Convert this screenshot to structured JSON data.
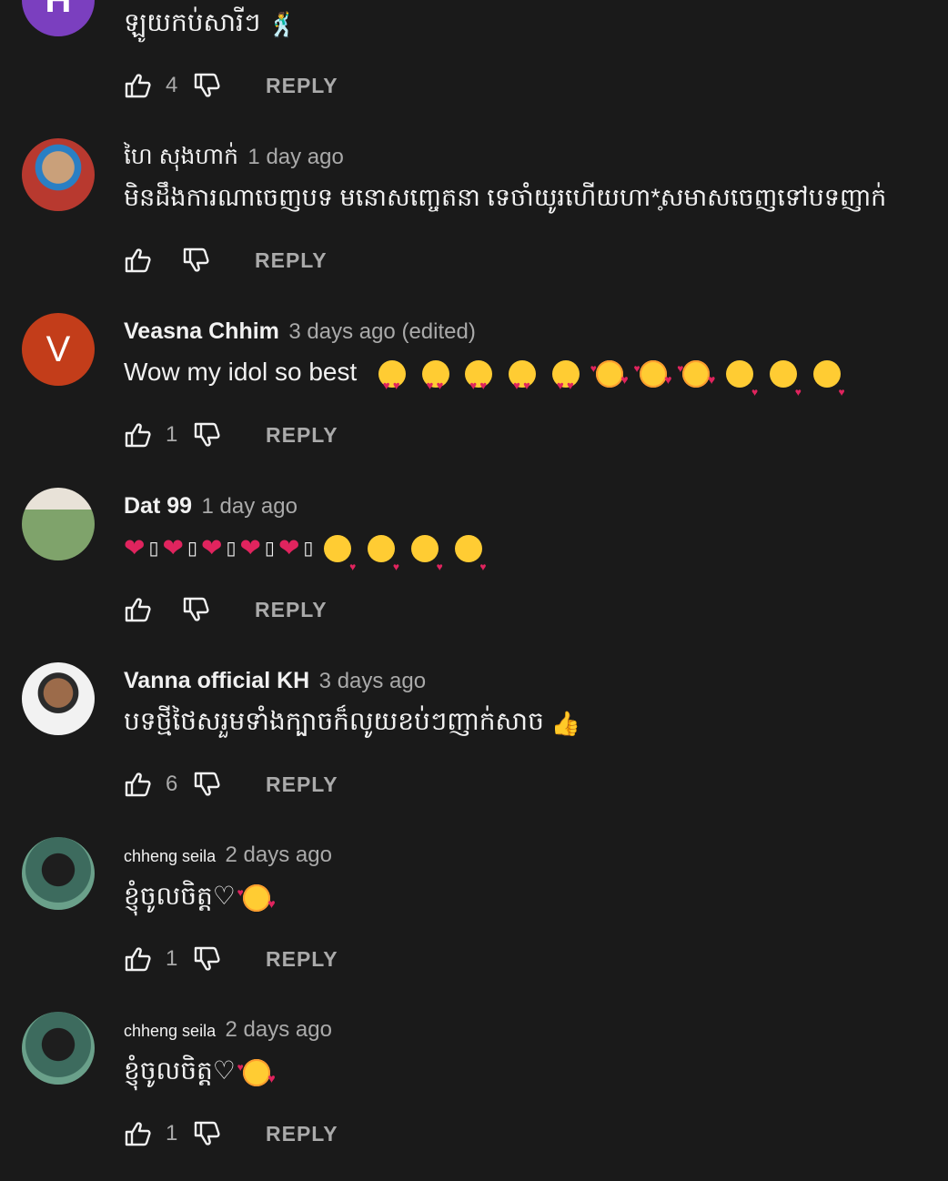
{
  "colors": {
    "background": "#1a1a1a",
    "text": "#f1f1f1",
    "muted": "#aaaaaa",
    "avatar_purple": "#7b3fbf",
    "avatar_orange": "#c33d1a"
  },
  "reply_label": "REPLY",
  "comments": [
    {
      "avatar": {
        "letter": "H",
        "color": "#7b3fbf"
      },
      "text": "ឡូយកប់សារីៗ",
      "likes": "4"
    },
    {
      "author": "ហៃ សុងហាក់",
      "time": "1 day ago",
      "text": "មិនដឹងការណាចេញបទ មនោសញ្ចេតនា ទេចាំយូរហើយហា*̥សមាសចេញទៅបទញាក់",
      "likes": ""
    },
    {
      "avatar": {
        "letter": "V",
        "color": "#c33d1a"
      },
      "author": "Veasna Chhim",
      "time": "3 days ago (edited)",
      "text": "Wow my idol so best",
      "likes": "1"
    },
    {
      "author": "Dat 99",
      "time": "1 day ago",
      "likes": ""
    },
    {
      "author": "Vanna official KH",
      "time": "3 days ago",
      "text": "បទថ្មីថៃសរួមទាំងក្បាចក៏លូយខប់ៗញាក់សាច",
      "likes": "6"
    },
    {
      "author": "chheng seila",
      "time": "2 days ago",
      "text": "ខ្ញុំចូលចិត្ត♡",
      "likes": "1"
    },
    {
      "author": "chheng seila",
      "time": "2 days ago",
      "text": "ខ្ញុំចូលចិត្ត♡",
      "likes": "1"
    }
  ]
}
